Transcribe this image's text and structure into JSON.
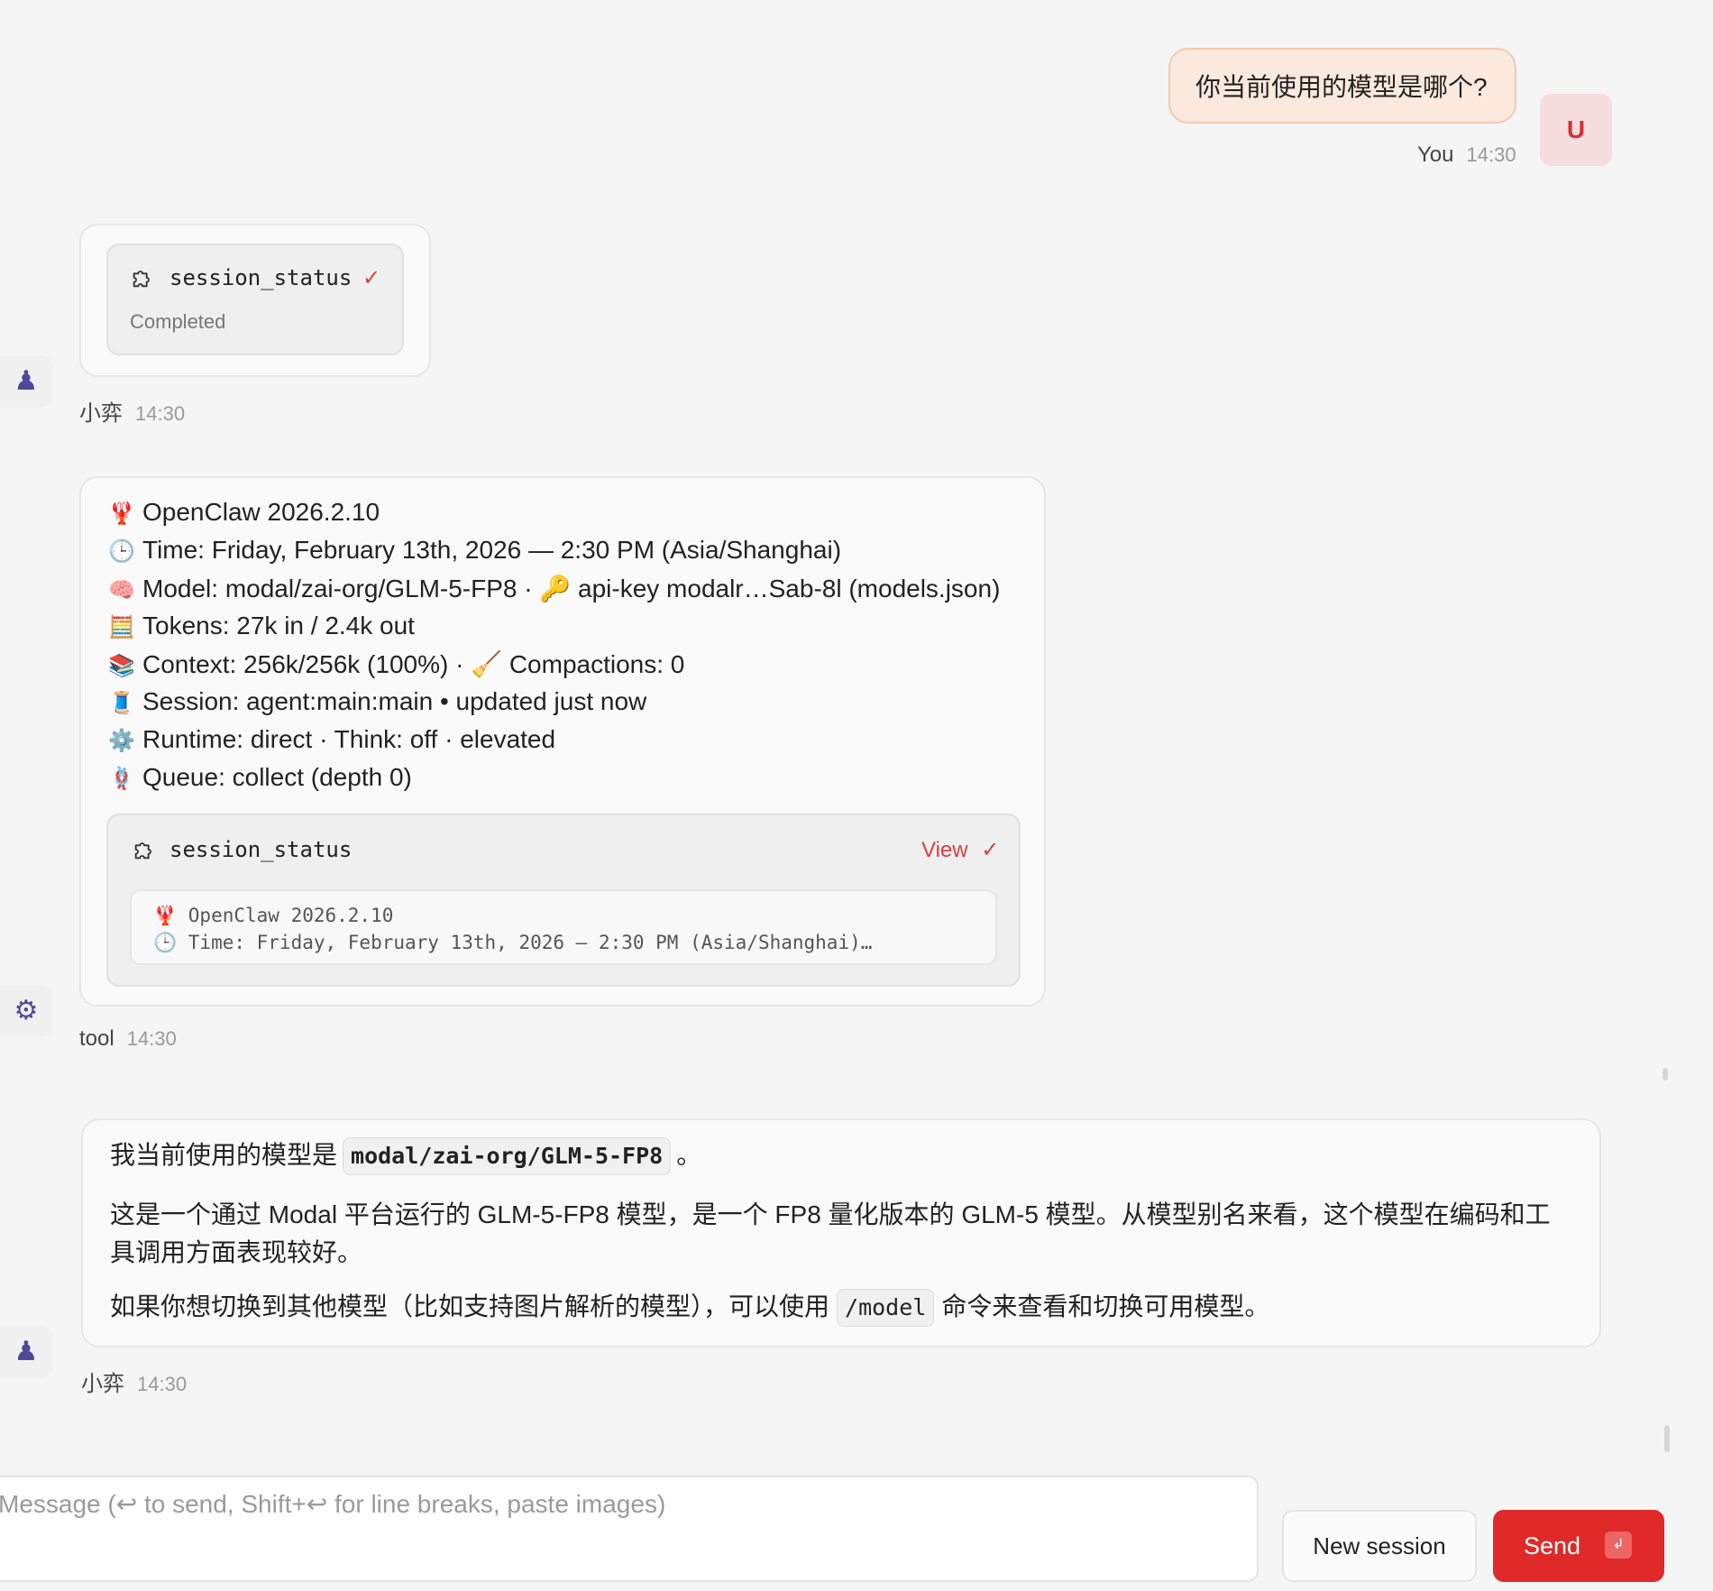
{
  "user_message": {
    "text": "你当前使用的模型是哪个?",
    "sender": "You",
    "time": "14:30",
    "avatar_letter": "U"
  },
  "tool_call_message": {
    "tool_name": "session_status",
    "status": "Completed",
    "sender": "小弈",
    "time": "14:30"
  },
  "tool_result_message": {
    "lines": [
      {
        "emoji": "🦞",
        "text": "OpenClaw 2026.2.10"
      },
      {
        "emoji": "🕒",
        "text": "Time: Friday, February 13th, 2026 — 2:30 PM (Asia/Shanghai)"
      },
      {
        "emoji": "🧠",
        "text": "Model: modal/zai-org/GLM-5-FP8 · 🔑 api-key modalr…Sab-8l (models.json)"
      },
      {
        "emoji": "🧮",
        "text": "Tokens: 27k in / 2.4k out"
      },
      {
        "emoji": "📚",
        "text": "Context: 256k/256k (100%) · 🧹 Compactions: 0"
      },
      {
        "emoji": "🧵",
        "text": "Session: agent:main:main • updated just now"
      },
      {
        "emoji": "⚙️",
        "text": "Runtime: direct · Think: off · elevated"
      },
      {
        "emoji": "🪢",
        "text": "Queue: collect (depth 0)"
      }
    ],
    "tool_name": "session_status",
    "view_label": "View",
    "preview_lines": [
      "🦞 OpenClaw 2026.2.10",
      "🕒 Time: Friday, February 13th, 2026 — 2:30 PM (Asia/Shanghai)…"
    ],
    "sender": "tool",
    "time": "14:30"
  },
  "assistant_reply": {
    "p1_prefix": "我当前使用的模型是",
    "p1_code": "modal/zai-org/GLM-5-FP8",
    "p1_suffix": "。",
    "p2": "这是一个通过 Modal 平台运行的 GLM-5-FP8 模型，是一个 FP8 量化版本的 GLM-5 模型。从模型别名来看，这个模型在编码和工具调用方面表现较好。",
    "p3_prefix": "如果你想切换到其他模型（比如支持图片解析的模型），可以使用",
    "p3_code": "/model",
    "p3_suffix": "命令来查看和切换可用模型。",
    "sender": "小弈",
    "time": "14:30"
  },
  "composer": {
    "placeholder": "Message (↩ to send, Shift+↩ for line breaks, paste images)",
    "new_session_label": "New session",
    "send_label": "Send",
    "send_key_glyph": "↲"
  },
  "icons": {
    "agent_avatar": "♟",
    "tool_avatar": "⚙",
    "puzzle": "puzzle-icon",
    "check": "✓"
  },
  "colors": {
    "accent": "#e02a2a",
    "user_bubble": "#fbe9dd",
    "user_avatar_bg": "#f6dede"
  }
}
